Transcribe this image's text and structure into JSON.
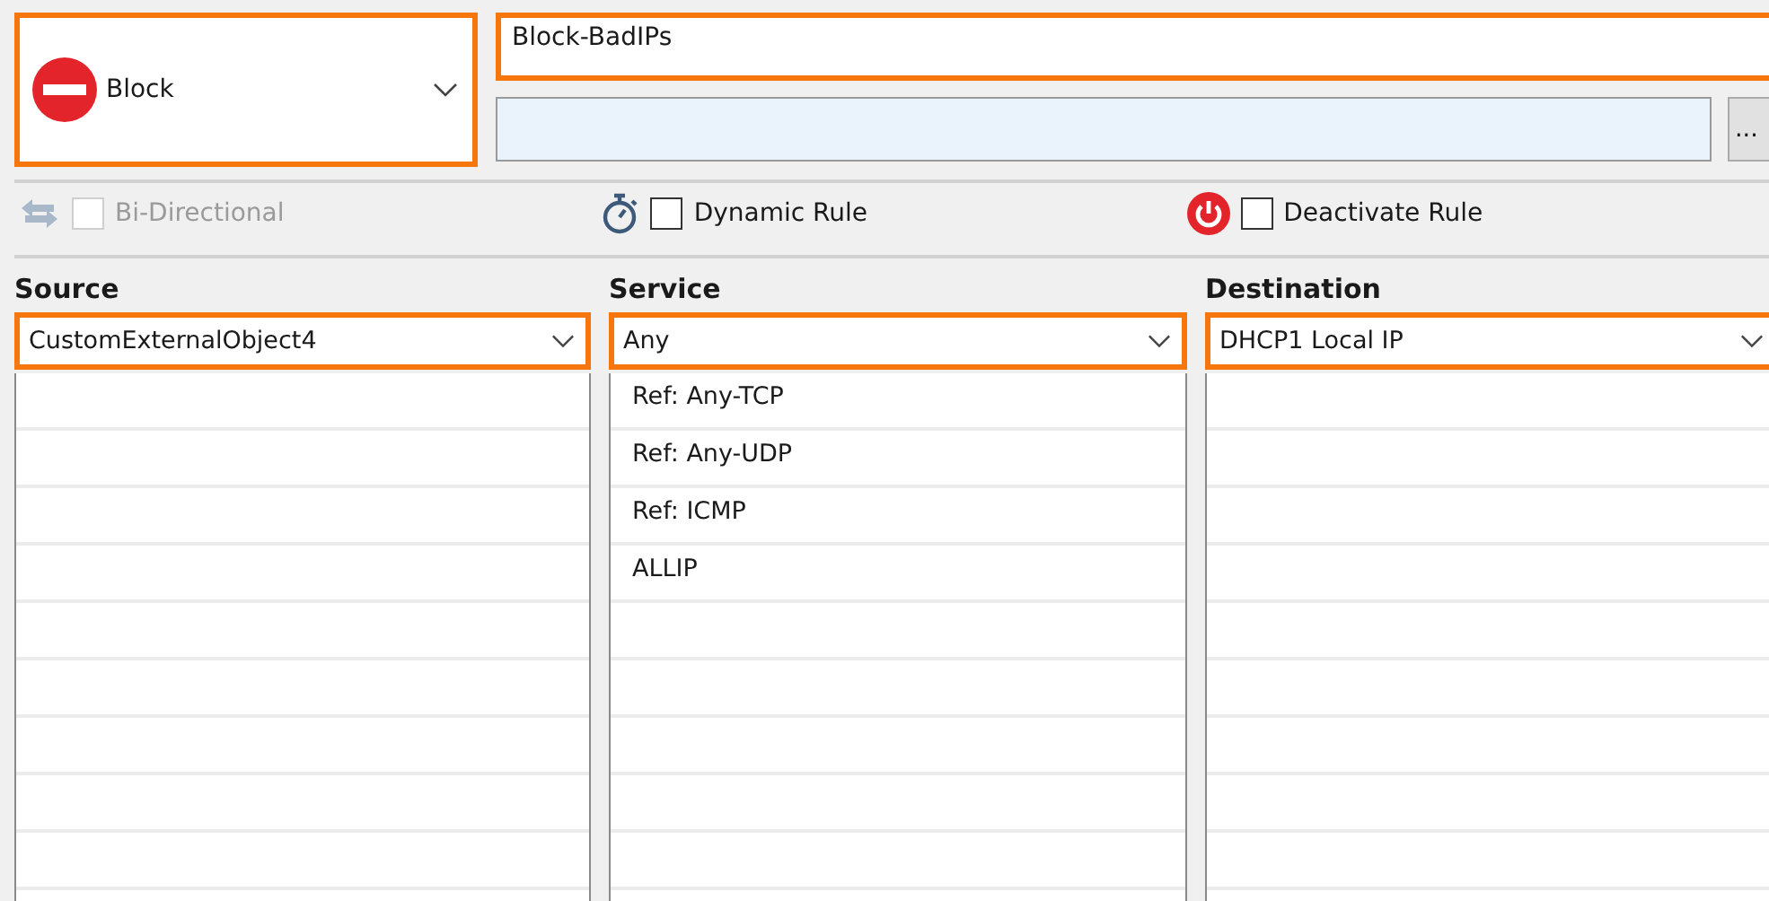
{
  "action": {
    "label": "Block"
  },
  "rule_name": {
    "value": "Block-BadIPs"
  },
  "browse_button": {
    "label": "..."
  },
  "options": [
    {
      "kind": "bidirectional",
      "label": "Bi-Directional",
      "checked": false,
      "disabled": true
    },
    {
      "kind": "dynamic",
      "label": "Dynamic Rule",
      "checked": false,
      "disabled": false
    },
    {
      "kind": "deactivate",
      "label": "Deactivate Rule",
      "checked": false,
      "disabled": false
    }
  ],
  "columns": [
    {
      "heading": "Source",
      "value": "CustomExternalObject4"
    },
    {
      "heading": "Service",
      "value": "Any",
      "items": [
        "Ref: Any-TCP",
        "Ref: Any-UDP",
        "Ref: ICMP",
        "ALLIP"
      ]
    },
    {
      "heading": "Destination",
      "value": "DHCP1 Local IP"
    }
  ]
}
